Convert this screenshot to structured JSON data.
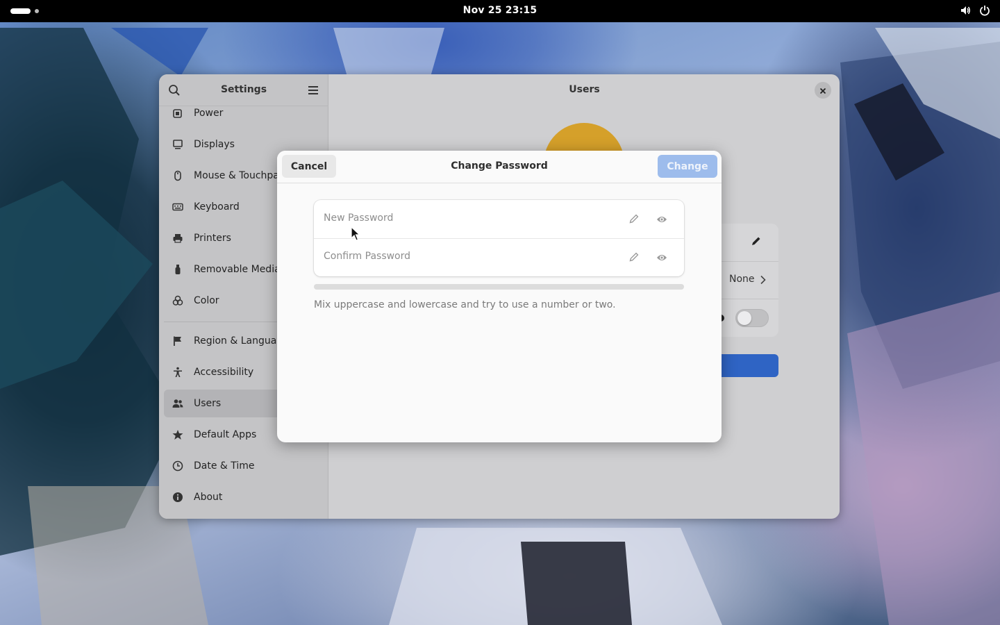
{
  "topbar": {
    "clock": "Nov 25  23:15",
    "tray_icons": [
      "volume-icon",
      "power-icon"
    ]
  },
  "settings": {
    "sidebar_title": "Settings",
    "content_title": "Users",
    "items": [
      {
        "label": "Power",
        "icon": "power-icon"
      },
      {
        "label": "Displays",
        "icon": "display-icon"
      },
      {
        "label": "Mouse & Touchpad",
        "icon": "mouse-icon"
      },
      {
        "label": "Keyboard",
        "icon": "keyboard-icon"
      },
      {
        "label": "Printers",
        "icon": "printer-icon"
      },
      {
        "label": "Removable Media",
        "icon": "usb-icon"
      },
      {
        "label": "Color",
        "icon": "color-icon"
      },
      {
        "label": "Region & Language",
        "icon": "flag-icon"
      },
      {
        "label": "Accessibility",
        "icon": "accessibility-icon"
      },
      {
        "label": "Users",
        "icon": "users-icon",
        "selected": true
      },
      {
        "label": "Default Apps",
        "icon": "star-icon"
      },
      {
        "label": "Date & Time",
        "icon": "clock-icon"
      },
      {
        "label": "About",
        "icon": "info-icon"
      }
    ],
    "background_panel": {
      "autologin_value": "None"
    }
  },
  "dialog": {
    "title": "Change Password",
    "cancel_label": "Cancel",
    "change_label": "Change",
    "change_enabled": false,
    "new_password_placeholder": "New Password",
    "confirm_password_placeholder": "Confirm Password",
    "strength_level": 0,
    "hint": "Mix uppercase and lowercase and try to use a number or two."
  },
  "colors": {
    "accent": "#3584e4",
    "accent_disabled": "#9dbcec",
    "avatar": "#d5a02a"
  }
}
